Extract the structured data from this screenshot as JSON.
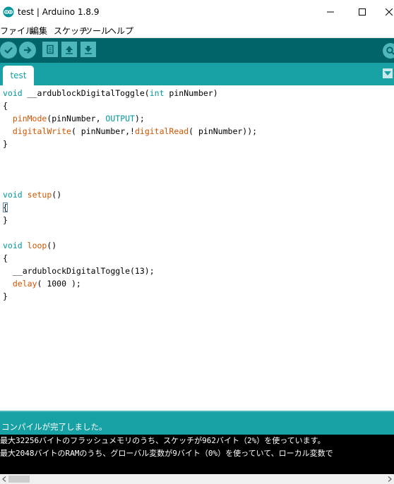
{
  "window": {
    "title": "test | Arduino 1.8.9"
  },
  "menu": {
    "items": [
      "ファイル",
      "編集",
      "スケッチ",
      "ツール",
      "ヘルプ"
    ]
  },
  "toolbar": {
    "buttons": [
      "verify",
      "upload",
      "new",
      "open",
      "save",
      "serial-monitor"
    ]
  },
  "tabs": {
    "active": "test"
  },
  "editor": {
    "lines": [
      {
        "parts": [
          {
            "t": "void",
            "c": "kw"
          },
          {
            "t": " __ardublockDigitalToggle(",
            "c": ""
          },
          {
            "t": "int",
            "c": "kw"
          },
          {
            "t": " pinNumber)",
            "c": ""
          }
        ]
      },
      {
        "parts": [
          {
            "t": "{",
            "c": ""
          }
        ]
      },
      {
        "parts": [
          {
            "t": "  ",
            "c": ""
          },
          {
            "t": "pinMode",
            "c": "fn"
          },
          {
            "t": "(pinNumber, ",
            "c": ""
          },
          {
            "t": "OUTPUT",
            "c": "cn"
          },
          {
            "t": ");",
            "c": ""
          }
        ]
      },
      {
        "parts": [
          {
            "t": "  ",
            "c": ""
          },
          {
            "t": "digitalWrite",
            "c": "fn"
          },
          {
            "t": "( pinNumber,!",
            "c": ""
          },
          {
            "t": "digitalRead",
            "c": "fn"
          },
          {
            "t": "( pinNumber));",
            "c": ""
          }
        ]
      },
      {
        "parts": [
          {
            "t": "}",
            "c": ""
          }
        ]
      },
      {
        "parts": []
      },
      {
        "parts": []
      },
      {
        "parts": []
      },
      {
        "parts": [
          {
            "t": "void",
            "c": "kw"
          },
          {
            "t": " ",
            "c": ""
          },
          {
            "t": "setup",
            "c": "fn"
          },
          {
            "t": "()",
            "c": ""
          }
        ]
      },
      {
        "parts": [
          {
            "t": "{",
            "c": "caret"
          }
        ]
      },
      {
        "parts": [
          {
            "t": "}",
            "c": ""
          }
        ]
      },
      {
        "parts": []
      },
      {
        "parts": [
          {
            "t": "void",
            "c": "kw"
          },
          {
            "t": " ",
            "c": ""
          },
          {
            "t": "loop",
            "c": "fn"
          },
          {
            "t": "()",
            "c": ""
          }
        ]
      },
      {
        "parts": [
          {
            "t": "{",
            "c": ""
          }
        ]
      },
      {
        "parts": [
          {
            "t": "  __ardublockDigitalToggle(13);",
            "c": ""
          }
        ]
      },
      {
        "parts": [
          {
            "t": "  ",
            "c": ""
          },
          {
            "t": "delay",
            "c": "fn"
          },
          {
            "t": "( 1000 );",
            "c": ""
          }
        ]
      },
      {
        "parts": [
          {
            "t": "}",
            "c": ""
          }
        ]
      }
    ]
  },
  "status": {
    "message": "コンパイルが完了しました。"
  },
  "console": {
    "lines": [
      "最大32256バイトのフラッシュメモリのうち、スケッチが962バイト（2%）を使っています。",
      "最大2048バイトのRAMのうち、グローバル変数が9バイト（0%）を使っていて、ローカル変数で"
    ]
  },
  "colors": {
    "toolbar": "#006468",
    "tabstrip": "#17a1a5",
    "button": "#4db7bb",
    "keyword": "#00979c",
    "function": "#d35400"
  }
}
